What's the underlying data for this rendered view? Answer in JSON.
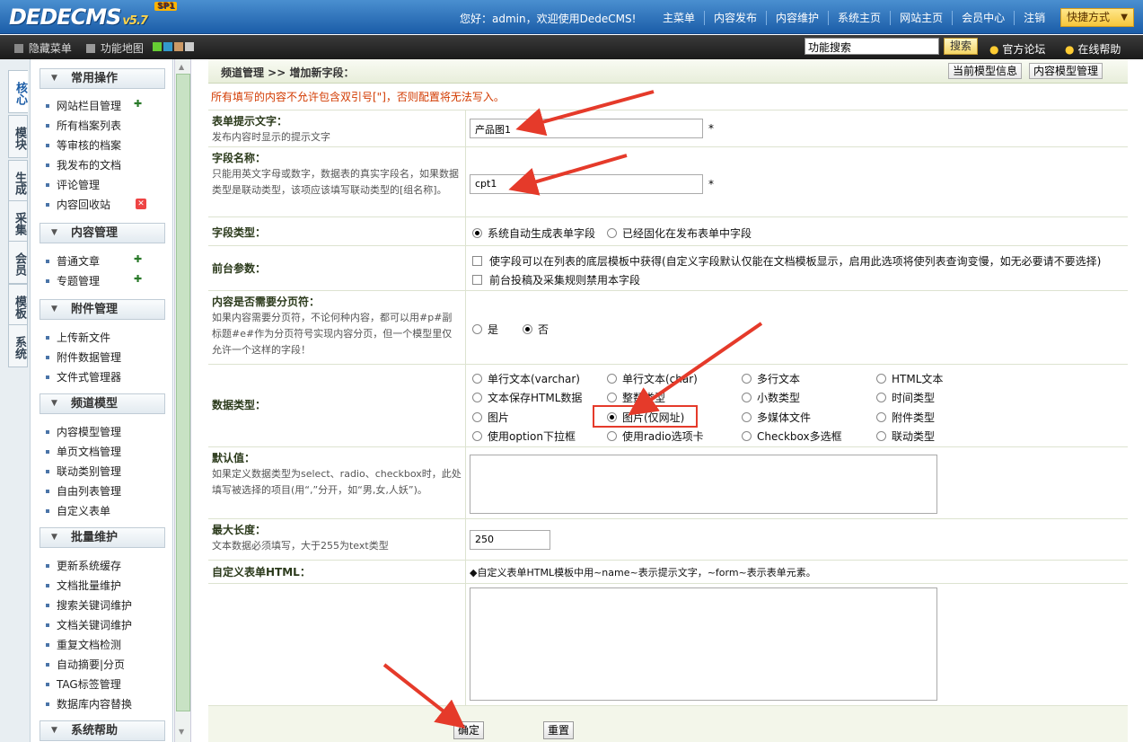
{
  "header": {
    "logo": "DEDECMS",
    "logo_version": "v5.7",
    "logo_badge": "SP1",
    "welcome": "您好：admin，欢迎使用DedeCMS!",
    "nav": [
      "主菜单",
      "内容发布",
      "内容维护",
      "系统主页",
      "网站主页",
      "会员中心",
      "注销"
    ],
    "quick": "快捷方式"
  },
  "toolbar": {
    "hide_menu": "隐藏菜单",
    "site_map": "功能地图",
    "search_value": "功能搜索",
    "search_button": "搜索",
    "forum": "官方论坛",
    "help": "在线帮助"
  },
  "vtabs": [
    "核心",
    "模块",
    "生成",
    "采集",
    "会员",
    "模板",
    "系统"
  ],
  "menu": {
    "sections": [
      {
        "title": "常用操作",
        "items": [
          "网站栏目管理",
          "所有档案列表",
          "等审核的档案",
          "我发布的文档",
          "评论管理",
          "内容回收站"
        ]
      },
      {
        "title": "内容管理",
        "items": [
          "普通文章",
          "专题管理"
        ]
      },
      {
        "title": "附件管理",
        "items": [
          "上传新文件",
          "附件数据管理",
          "文件式管理器"
        ]
      },
      {
        "title": "频道模型",
        "items": [
          "内容模型管理",
          "单页文档管理",
          "联动类别管理",
          "自由列表管理",
          "自定义表单"
        ]
      },
      {
        "title": "批量维护",
        "items": [
          "更新系统缓存",
          "文档批量维护",
          "搜索关键词维护",
          "文档关键词维护",
          "重复文档检测",
          "自动摘要|分页",
          "TAG标签管理",
          "数据库内容替换"
        ]
      },
      {
        "title": "系统帮助",
        "items": []
      }
    ]
  },
  "main": {
    "breadcrumb": "频道管理 >> 增加新字段：",
    "btn_model_info": "当前模型信息",
    "btn_model_manage": "内容模型管理",
    "warning": "所有填写的内容不允许包含双引号[\"]，否则配置将无法写入。",
    "field_label": {
      "label": "表单提示文字：",
      "desc": "发布内容时显示的提示文字",
      "value": "产品图1"
    },
    "field_name": {
      "label": "字段名称：",
      "desc": "只能用英文字母或数字，数据表的真实字段名，如果数据类型是联动类型，该项应该填写联动类型的[组名称]。",
      "value": "cpt1"
    },
    "field_type": {
      "label": "字段类型：",
      "options": [
        "系统自动生成表单字段",
        "已经固化在发布表单中字段"
      ]
    },
    "front_param": {
      "label": "前台参数：",
      "options": [
        "使字段可以在列表的底层模板中获得(自定义字段默认仅能在文档模板显示，启用此选项将使列表查询变慢，如无必要请不要选择)",
        "前台投稿及采集规则禁用本字段"
      ]
    },
    "paging": {
      "label": "内容是否需要分页符：",
      "desc": "如果内容需要分页符，不论何种内容，都可以用#p#副标题#e#作为分页符号实现内容分页，但一个模型里仅允许一个这样的字段！",
      "options": [
        "是",
        "否"
      ]
    },
    "data_type": {
      "label": "数据类型：",
      "options": [
        "单行文本(varchar)",
        "单行文本(char)",
        "多行文本",
        "HTML文本",
        "文本保存HTML数据",
        "整数类型",
        "小数类型",
        "时间类型",
        "图片",
        "图片(仅网址)",
        "多媒体文件",
        "附件类型",
        "使用option下拉框",
        "使用radio选项卡",
        "Checkbox多选框",
        "联动类型"
      ]
    },
    "default_value": {
      "label": "默认值：",
      "desc": "如果定义数据类型为select、radio、checkbox时，此处填写被选择的项目(用“,”分开，如“男,女,人妖”)。"
    },
    "max_length": {
      "label": "最大长度：",
      "desc": "文本数据必须填写，大于255为text类型",
      "value": "250"
    },
    "custom_html": {
      "label": "自定义表单HTML：",
      "hint": "◆自定义表单HTML模板中用~name~表示提示文字，~form~表示表单元素。"
    },
    "submit": "确定",
    "reset": "重置"
  }
}
